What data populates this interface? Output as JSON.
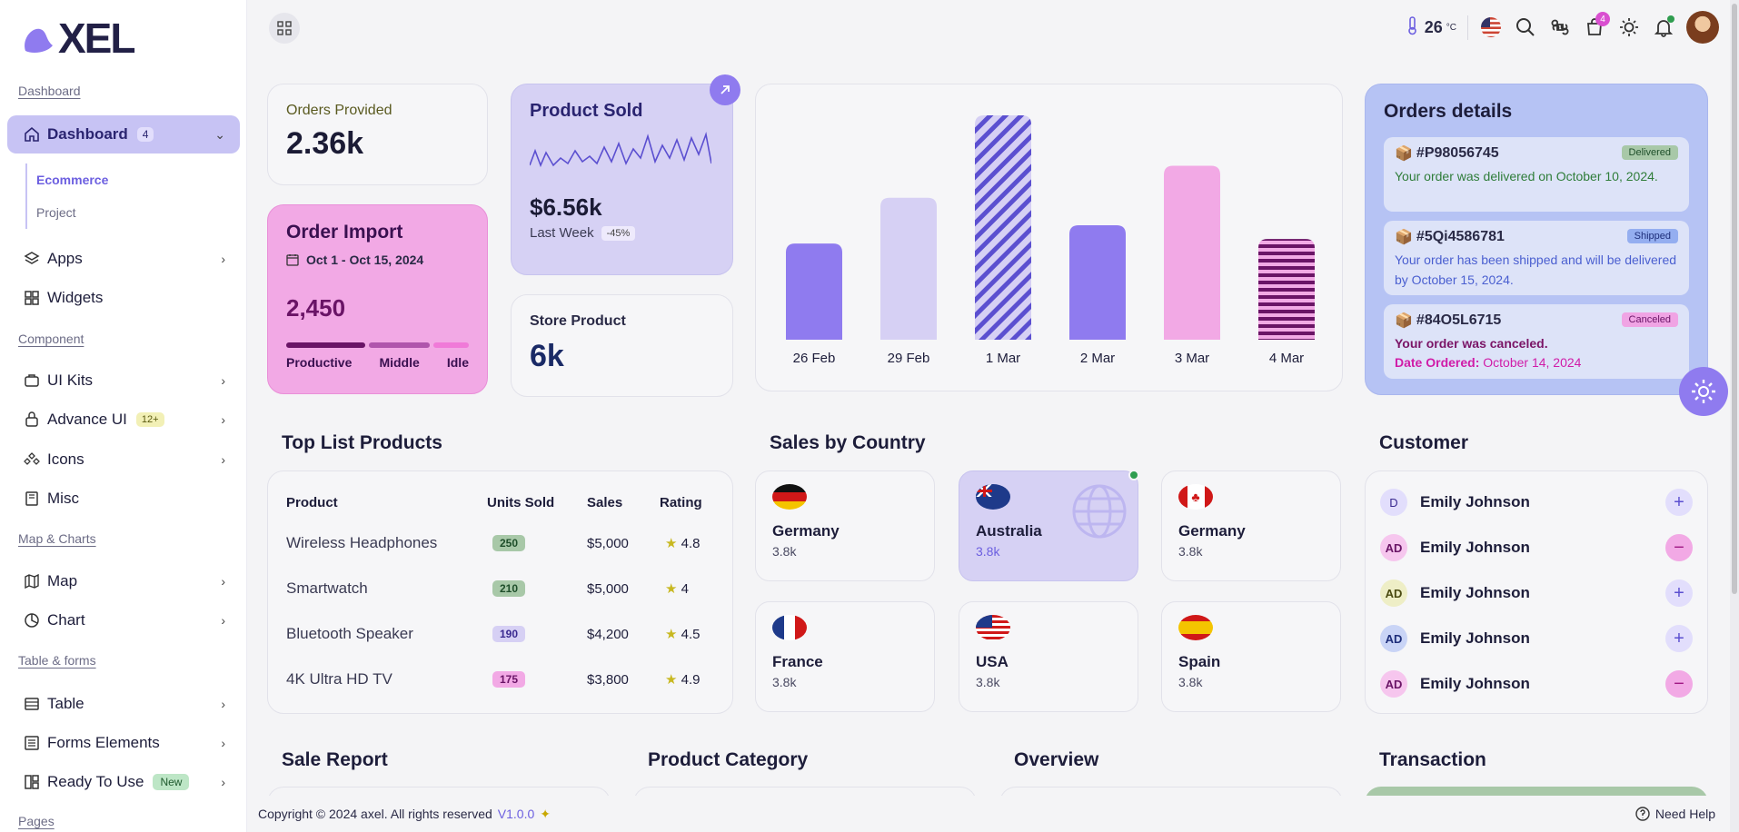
{
  "brand": {
    "logo_text": "XEL",
    "colors": {
      "accent": "#6c5fe0",
      "active_bg": "#c7c3f4",
      "pink": "#f2a9e5",
      "lavender": "#d6d1f4",
      "blue_card": "#b6c3f4"
    }
  },
  "sidebar": {
    "sections": {
      "dashboard": "Dashboard",
      "component": "Component",
      "map_charts": "Map & Charts",
      "table_forms": "Table & forms",
      "pages": "Pages"
    },
    "dashboard": {
      "label": "Dashboard",
      "badge": "4"
    },
    "sub_items": [
      "Ecommerce",
      "Project"
    ],
    "items": {
      "apps": "Apps",
      "widgets": "Widgets",
      "ui_kits": "UI Kits",
      "advance_ui": "Advance UI",
      "advance_badge": "12+",
      "icons": "Icons",
      "misc": "Misc",
      "map": "Map",
      "chart": "Chart",
      "table": "Table",
      "forms": "Forms Elements",
      "ready": "Ready To Use",
      "ready_badge": "New"
    }
  },
  "topbar": {
    "temperature": "26",
    "temp_unit": "°C",
    "cart_count": "4"
  },
  "orders_provided": {
    "label": "Orders Provided",
    "value": "2.36k"
  },
  "product_sold": {
    "label": "Product Sold",
    "value": "$6.56k",
    "period": "Last Week",
    "change": "-45%"
  },
  "order_import": {
    "label": "Order Import",
    "date_range": "Oct 1 - Oct 15, 2024",
    "value": "2,450",
    "legend": [
      "Productive",
      "Middle",
      "Idle"
    ],
    "segments": [
      0.45,
      0.35,
      0.2
    ],
    "segment_colors": [
      "#6a1466",
      "#b055ac",
      "#f07ad8"
    ]
  },
  "store_product": {
    "label": "Store Product",
    "value": "6k"
  },
  "chart_data": {
    "type": "bar",
    "categories": [
      "26 Feb",
      "29 Feb",
      "1 Mar",
      "2 Mar",
      "3 Mar",
      "4 Mar"
    ],
    "values": [
      42,
      62,
      98,
      50,
      76,
      44
    ],
    "colors": [
      "#8f7bef",
      "#d6d0f4",
      "hatch-lavender",
      "#8f7bef",
      "#f2a9e5",
      "stripes-purple"
    ],
    "ylim": [
      0,
      100
    ]
  },
  "orders_details": {
    "title": "Orders details",
    "items": [
      {
        "id": "#P98056745",
        "status": "Delivered",
        "text": "Your order was delivered on October 10, 2024."
      },
      {
        "id": "#5Qi4586781",
        "status": "Shipped",
        "text": "Your order has been shipped and will be delivered by October 15, 2024."
      },
      {
        "id": "#84O5L6715",
        "status": "Canceled",
        "text": "Your order was canceled.",
        "date_label": "Date Ordered:",
        "date": "October 14, 2024"
      }
    ]
  },
  "top_products": {
    "title": "Top List Products",
    "headers": [
      "Product",
      "Units Sold",
      "Sales",
      "Rating"
    ],
    "rows": [
      {
        "product": "Wireless Headphones",
        "units": "250",
        "sales": "$5,000",
        "rating": "4.8"
      },
      {
        "product": "Smartwatch",
        "units": "210",
        "sales": "$5,000",
        "rating": "4"
      },
      {
        "product": "Bluetooth Speaker",
        "units": "190",
        "sales": "$4,200",
        "rating": "4.5"
      },
      {
        "product": "4K Ultra HD TV",
        "units": "175",
        "sales": "$3,800",
        "rating": "4.9"
      }
    ]
  },
  "sales_by_country": {
    "title": "Sales by Country",
    "countries": [
      {
        "name": "Germany",
        "value": "3.8k"
      },
      {
        "name": "Australia",
        "value": "3.8k"
      },
      {
        "name": "Germany",
        "value": "3.8k"
      },
      {
        "name": "France",
        "value": "3.8k"
      },
      {
        "name": "USA",
        "value": "3.8k"
      },
      {
        "name": "Spain",
        "value": "3.8k"
      }
    ]
  },
  "customer": {
    "title": "Customer",
    "rows": [
      {
        "initials": "D",
        "name": "Emily Johnson",
        "action": "+"
      },
      {
        "initials": "AD",
        "name": "Emily Johnson",
        "action": "−"
      },
      {
        "initials": "AD",
        "name": "Emily Johnson",
        "action": "+"
      },
      {
        "initials": "AD",
        "name": "Emily Johnson",
        "action": "+"
      },
      {
        "initials": "AD",
        "name": "Emily Johnson",
        "action": "−"
      }
    ]
  },
  "bottom_sections": {
    "sale_report": "Sale Report",
    "product_category": "Product Category",
    "overview": "Overview",
    "transaction": "Transaction"
  },
  "footer": {
    "copyright": "Copyright © 2024 axel. All rights reserved",
    "version": "V1.0.0",
    "help": "Need Help"
  }
}
